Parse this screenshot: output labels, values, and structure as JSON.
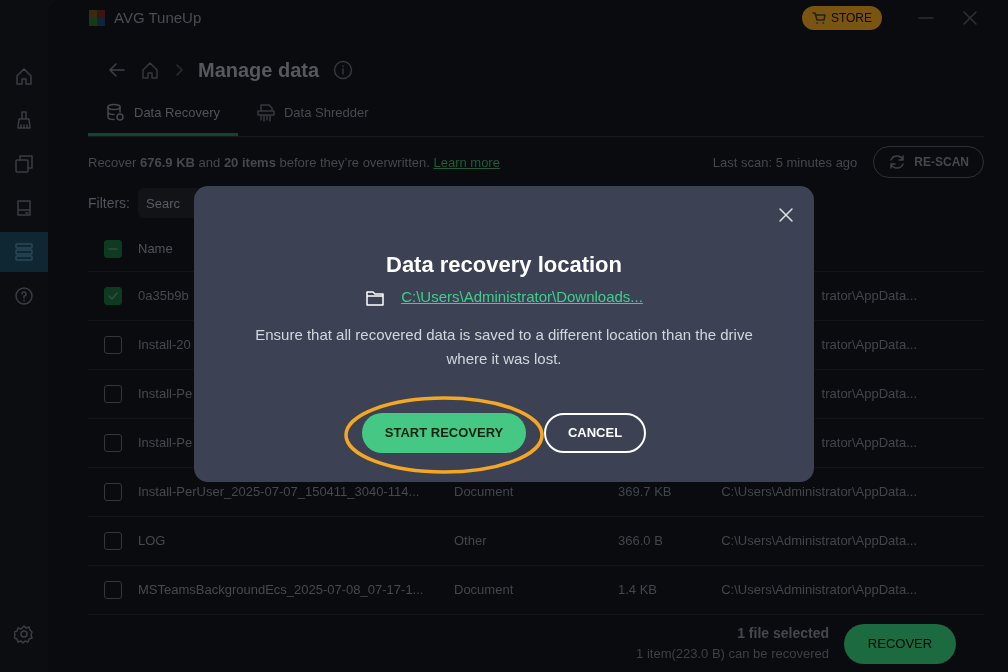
{
  "app": {
    "title": "AVG TuneUp",
    "store": "STORE"
  },
  "sidebar": {
    "items": [
      {
        "kind": "home",
        "selected": false
      },
      {
        "kind": "brush",
        "selected": false
      },
      {
        "kind": "windows",
        "selected": false
      },
      {
        "kind": "drive",
        "selected": false
      },
      {
        "kind": "list",
        "selected": true
      },
      {
        "kind": "help",
        "selected": false
      }
    ]
  },
  "header": {
    "title": "Manage data"
  },
  "tabs": [
    {
      "label": "Data Recovery",
      "kind": "recovery",
      "selected": true
    },
    {
      "label": "Data Shredder",
      "kind": "shredder",
      "selected": false
    }
  ],
  "summary": {
    "text": "Recover **676.9 KB** and **20 items** before they’re overwritten.",
    "link": "Learn more",
    "last_scan": "Last scan: 5 minutes ago",
    "rescan": "RE-SCAN"
  },
  "filters": {
    "label": "Filters:",
    "search": {
      "placeholder": "Searc"
    }
  },
  "table": {
    "select_all": {
      "checked": false,
      "indeterminate": true
    },
    "columns": [
      {
        "label": "Name"
      }
    ],
    "rows": [
      {
        "checked": true,
        "name": "0a35b9b",
        "path": "trator\\AppData..."
      },
      {
        "checked": false,
        "name": "Install-20",
        "path": "trator\\AppData..."
      },
      {
        "checked": false,
        "name": "Install-Pe",
        "path": "trator\\AppData..."
      },
      {
        "checked": false,
        "name": "Install-Pe",
        "path": "trator\\AppData..."
      },
      {
        "checked": false,
        "name": "Install-PerUser_2025-07-07_150411_3040-114...",
        "type": "Document",
        "size": "369.7 KB",
        "path": "C:\\Users\\Administrator\\AppData..."
      },
      {
        "checked": false,
        "name": "LOG",
        "type": "Other",
        "size": "366.0 B",
        "path": "C:\\Users\\Administrator\\AppData..."
      },
      {
        "checked": false,
        "name": "MSTeamsBackgroundEcs_2025-07-08_07-17-1...",
        "type": "Document",
        "size": "1.4 KB",
        "path": "C:\\Users\\Administrator\\AppData..."
      }
    ]
  },
  "footer": {
    "selected": "1 file selected",
    "detail": "1 item(223.0 B) can be recovered",
    "recover": "RECOVER"
  },
  "dialog": {
    "title": "Data recovery location",
    "path": "C:\\Users\\Administrator\\Downloads...",
    "message": "Ensure that all recovered data is saved to a different location than the drive where it was lost.",
    "primary": "START RECOVERY",
    "secondary": "CANCEL",
    "highlighted": true
  }
}
